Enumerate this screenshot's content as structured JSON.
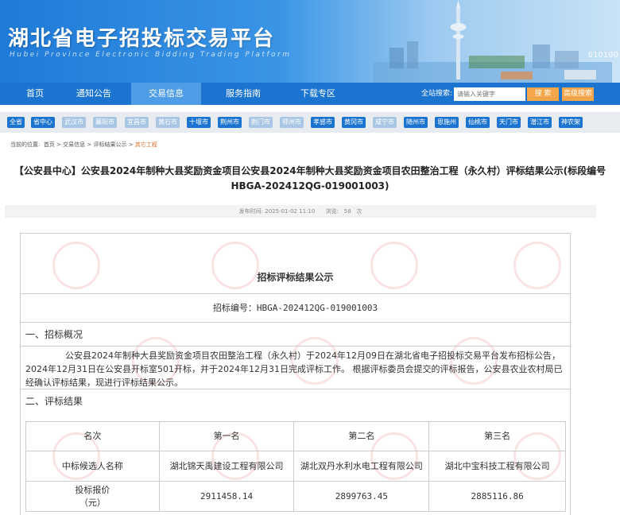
{
  "header": {
    "title": "湖北省电子招投标交易平台",
    "subtitle": "Hubei Province Electronic Bidding Trading Platform",
    "code": "010100"
  },
  "nav": {
    "items": [
      {
        "label": "首页"
      },
      {
        "label": "通知公告"
      },
      {
        "label": "交易信息"
      },
      {
        "label": "服务指南"
      },
      {
        "label": "下载专区"
      }
    ],
    "search_label": "全站搜索:",
    "search_placeholder": "请输入关键字",
    "search_button": "搜 索",
    "advanced_button": "高级搜索"
  },
  "regions": [
    "全省",
    "省中心",
    "武汉市",
    "襄阳市",
    "宜昌市",
    "黄石市",
    "十堰市",
    "荆州市",
    "荆门市",
    "鄂州市",
    "孝感市",
    "黄冈市",
    "咸宁市",
    "随州市",
    "恩施州",
    "仙桃市",
    "天门市",
    "潜江市",
    "神农架"
  ],
  "breadcrumb": {
    "prefix": "当前的位置:",
    "items": [
      "首页",
      "交易信息",
      "评标结果公示"
    ],
    "current": "其它工程",
    "sep": ">"
  },
  "article": {
    "title": "【公安县中心】公安县2024年制种大县奖励资金项目公安县2024年制种大县奖励资金项目农田整治工程（永久村）评标结果公示(标段编号HBGA-202412QG-019001003)",
    "publish_label": "发布时间:",
    "publish_time": "2025-01-02 11:10",
    "views_label": "浏览:",
    "views": "58",
    "views_unit": "次"
  },
  "doc": {
    "heading": "招标评标结果公示",
    "bid_number": "招标编号：HBGA-202412QG-019001003",
    "section1": "一、招标概况",
    "paragraph": "公安县2024年制种大县奖励资金项目农田整治工程（永久村）于2024年12月09日在湖北省电子招投标交易平台发布招标公告，2024年12月31日在公安县开标室501开标，并于2024年12月31日完成评标工作。 根据评标委员会提交的评标报告，公安县农业农村局已经确认评标结果，现进行评标结果公示。",
    "section2": "二、评标结果",
    "table": {
      "headers": [
        "名次",
        "第一名",
        "第二名",
        "第三名"
      ],
      "rows": [
        [
          "中标候选人名称",
          "湖北锦天禹建设工程有限公司",
          "湖北双丹水利水电工程有限公司",
          "湖北中宝科技工程有限公司"
        ],
        [
          "投标报价\n（元）",
          "2911458.14",
          "2899763.45",
          "2885116.86"
        ]
      ]
    }
  },
  "colors": {
    "primary": "#1b74cf",
    "accent": "#f5a54a",
    "current": "#e0712b"
  }
}
